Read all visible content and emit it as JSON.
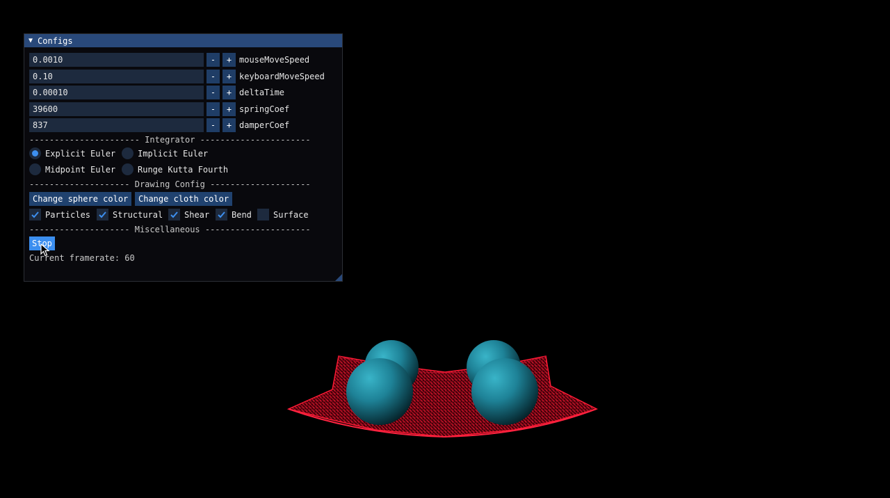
{
  "window": {
    "title": "Configs"
  },
  "params": [
    {
      "value": "0.0010",
      "label": "mouseMoveSpeed",
      "minus": "-",
      "plus": "+"
    },
    {
      "value": "0.10",
      "label": "keyboardMoveSpeed",
      "minus": "-",
      "plus": "+"
    },
    {
      "value": "0.00010",
      "label": "deltaTime",
      "minus": "-",
      "plus": "+"
    },
    {
      "value": "39600",
      "label": "springCoef",
      "minus": "-",
      "plus": "+"
    },
    {
      "value": "837",
      "label": "damperCoef",
      "minus": "-",
      "plus": "+"
    }
  ],
  "integrator": {
    "header": "---------------------- Integrator ----------------------",
    "options": [
      {
        "label": "Explicit Euler",
        "selected": true
      },
      {
        "label": "Implicit Euler",
        "selected": false
      },
      {
        "label": "Midpoint Euler",
        "selected": false
      },
      {
        "label": "Runge Kutta Fourth",
        "selected": false
      }
    ]
  },
  "drawing": {
    "header": "-------------------- Drawing Config --------------------",
    "sphere_color_button": "Change sphere color",
    "cloth_color_button": "Change cloth color",
    "checkboxes": [
      {
        "label": "Particles",
        "checked": true
      },
      {
        "label": "Structural",
        "checked": true
      },
      {
        "label": "Shear",
        "checked": true
      },
      {
        "label": "Bend",
        "checked": true
      },
      {
        "label": "Surface",
        "checked": false
      }
    ]
  },
  "misc": {
    "header": "-------------------- Miscellaneous ---------------------",
    "stop_button": "Stop",
    "framerate_text": "Current framerate: 60"
  },
  "colors": {
    "title_bar": "#29497a",
    "accent": "#3d8fef",
    "field_bg": "#1d2a3e",
    "cloth": "#d0102a",
    "sphere": "#1f7f92"
  }
}
